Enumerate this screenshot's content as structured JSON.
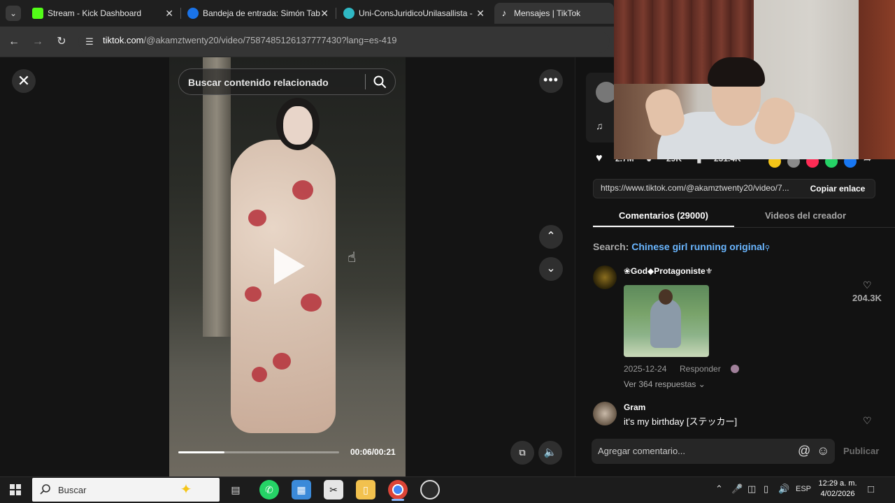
{
  "tabs": [
    {
      "title": "Stream - Kick Dashboard",
      "favicon_color": "#53fc18"
    },
    {
      "title": "Bandeja de entrada: Simón Tab",
      "favicon_color": "#1a73e8"
    },
    {
      "title": "Uni-ConsJuridicoUnilasallista -",
      "favicon_color": "#2fb8c4"
    },
    {
      "title": "Mensajes | TikTok",
      "favicon_color": "#ffffff"
    }
  ],
  "address_bar": {
    "domain": "tiktok.com",
    "path": "/@akamztwenty20/video/7587485126137777430?lang=es-419"
  },
  "video": {
    "search_placeholder": "Buscar contenido relacionado",
    "current_time": "00:06",
    "duration": "00:21",
    "time_label": "00:06/00:21",
    "progress": 0.285
  },
  "stats": {
    "likes": "2.7M",
    "comments": "29K",
    "saves": "231.4K"
  },
  "share": {
    "link": "https://www.tiktok.com/@akamztwenty20/video/7...",
    "copy_label": "Copiar enlace",
    "icon_colors": [
      "#f5c518",
      "#8a8a8a",
      "#fe2c55",
      "#25d366",
      "#1877f2"
    ]
  },
  "panel_tabs": {
    "comments": "Comentarios (29000)",
    "creator_videos": "Videos del creador"
  },
  "related_search": {
    "prefix": "Search:",
    "term": "Chinese girl running original"
  },
  "comments": [
    {
      "user": "God Protagoniste",
      "user_display": "❀God◆Protagoniste⚜",
      "date": "2025-12-24",
      "reply_label": "Responder",
      "replies": "Ver 364 respuestas",
      "likes": "204.3K",
      "has_image": true
    },
    {
      "user": "Gram",
      "text": "it's my birthday [ステッカー]"
    }
  ],
  "comment_input": {
    "placeholder": "Agregar comentario...",
    "publish_label": "Publicar"
  },
  "taskbar": {
    "search_placeholder": "Buscar",
    "language": "ESP",
    "time": "12:29 a. m.",
    "date": "4/02/2026"
  }
}
